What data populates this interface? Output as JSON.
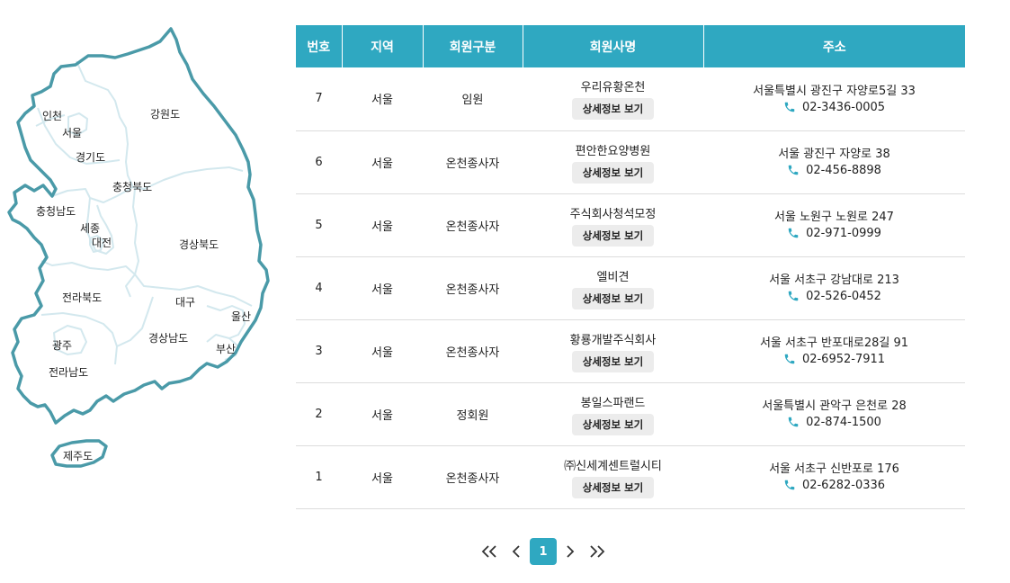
{
  "map": {
    "regions": [
      {
        "id": "incheon",
        "label": "인천"
      },
      {
        "id": "seoul",
        "label": "서울"
      },
      {
        "id": "gangwon",
        "label": "강원도"
      },
      {
        "id": "gyeonggi",
        "label": "경기도"
      },
      {
        "id": "chungbuk",
        "label": "충청북도"
      },
      {
        "id": "chungnam",
        "label": "충청남도"
      },
      {
        "id": "sejong",
        "label": "세종"
      },
      {
        "id": "daejeon",
        "label": "대전"
      },
      {
        "id": "gyeongbuk",
        "label": "경상북도"
      },
      {
        "id": "jeonbuk",
        "label": "전라북도"
      },
      {
        "id": "daegu",
        "label": "대구"
      },
      {
        "id": "ulsan",
        "label": "울산"
      },
      {
        "id": "gwangju",
        "label": "광주"
      },
      {
        "id": "gyeongnam",
        "label": "경상남도"
      },
      {
        "id": "busan",
        "label": "부산"
      },
      {
        "id": "jeonnam",
        "label": "전라남도"
      },
      {
        "id": "jeju",
        "label": "제주도"
      }
    ]
  },
  "table": {
    "headers": [
      "번호",
      "지역",
      "회원구분",
      "회원사명",
      "주소"
    ],
    "detail_label": "상세정보 보기",
    "rows": [
      {
        "no": "7",
        "region": "서울",
        "type": "임원",
        "name": "우리유황온천",
        "address": "서울특별시 광진구 자양로5길 33",
        "phone": "02-3436-0005"
      },
      {
        "no": "6",
        "region": "서울",
        "type": "온천종사자",
        "name": "편안한요양병원",
        "address": "서울 광진구 자양로 38",
        "phone": "02-456-8898"
      },
      {
        "no": "5",
        "region": "서울",
        "type": "온천종사자",
        "name": "주식회사청석모정",
        "address": "서울 노원구 노원로 247",
        "phone": "02-971-0999"
      },
      {
        "no": "4",
        "region": "서울",
        "type": "온천종사자",
        "name": "엘비견",
        "address": "서울 서초구 강남대로 213",
        "phone": "02-526-0452"
      },
      {
        "no": "3",
        "region": "서울",
        "type": "온천종사자",
        "name": "황룡개발주식회사",
        "address": "서울 서초구 반포대로28길 91",
        "phone": "02-6952-7911"
      },
      {
        "no": "2",
        "region": "서울",
        "type": "정회원",
        "name": "봉일스파랜드",
        "address": "서울특별시 관악구 은천로 28",
        "phone": "02-874-1500"
      },
      {
        "no": "1",
        "region": "서울",
        "type": "온천종사자",
        "name": "㈜신세계센트럴시티",
        "address": "서울 서초구 신반포로 176",
        "phone": "02-6282-0336"
      }
    ]
  },
  "pagination": {
    "current": "1",
    "first_icon": "double-chevron-left-icon",
    "prev_icon": "chevron-left-icon",
    "next_icon": "chevron-right-icon",
    "last_icon": "double-chevron-right-icon"
  },
  "colors": {
    "accent": "#2fa8c1",
    "map_outline": "#4a9aa8",
    "map_borders": "#d3e8ee"
  }
}
